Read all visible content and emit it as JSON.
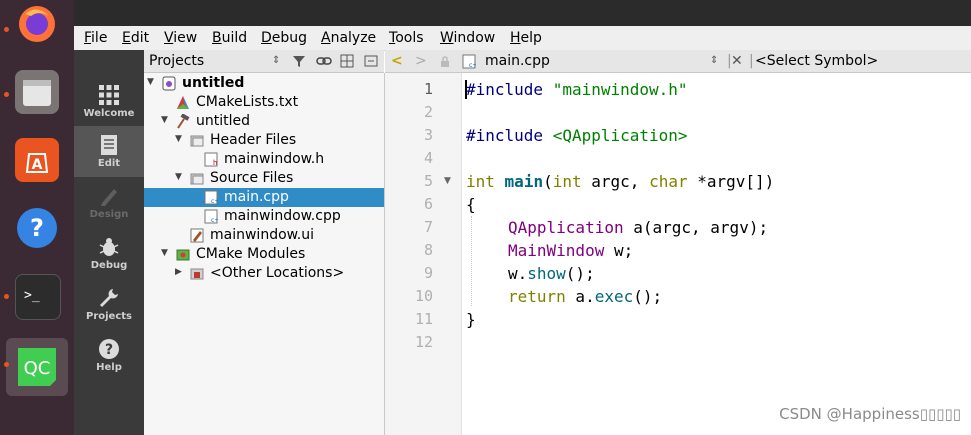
{
  "menubar": {
    "items": [
      "File",
      "Edit",
      "View",
      "Build",
      "Debug",
      "Analyze",
      "Tools",
      "Window",
      "Help"
    ]
  },
  "modes": [
    {
      "label": "Welcome",
      "icon": "welcome-grid-icon"
    },
    {
      "label": "Edit",
      "icon": "edit-document-icon"
    },
    {
      "label": "Design",
      "icon": "design-pen-icon"
    },
    {
      "label": "Debug",
      "icon": "debug-bug-icon"
    },
    {
      "label": "Projects",
      "icon": "projects-wrench-icon"
    },
    {
      "label": "Help",
      "icon": "help-question-icon"
    }
  ],
  "projects": {
    "title": "Projects",
    "tree": [
      {
        "label": "untitled",
        "bold": true
      },
      {
        "label": "CMakeLists.txt"
      },
      {
        "label": "untitled"
      },
      {
        "label": "Header Files"
      },
      {
        "label": "mainwindow.h"
      },
      {
        "label": "Source Files"
      },
      {
        "label": "main.cpp",
        "selected": true
      },
      {
        "label": "mainwindow.cpp"
      },
      {
        "label": "mainwindow.ui"
      },
      {
        "label": "CMake Modules"
      },
      {
        "label": "<Other Locations>"
      }
    ]
  },
  "editor": {
    "file_name": "main.cpp",
    "symbol_selector": "<Select Symbol>",
    "line_numbers": [
      "1",
      "2",
      "3",
      "4",
      "5",
      "6",
      "7",
      "8",
      "9",
      "10",
      "11",
      "12"
    ],
    "code": {
      "l1_directive": "#include",
      "l1_string": "\"mainwindow.h\"",
      "l3_directive": "#include",
      "l3_string": "<QApplication>",
      "l5_int": "int",
      "l5_main": "main",
      "l5_paren": "(",
      "l5_int2": "int",
      "l5_argc": " argc, ",
      "l5_char": "char",
      "l5_argv": " *argv[])",
      "l6": "{",
      "l7_type": "QApplication",
      "l7_rest": " a(argc, argv);",
      "l8_type": "MainWindow",
      "l8_rest": " w;",
      "l9_obj": "w.",
      "l9_call": "show",
      "l9_rest": "();",
      "l10_return": "return",
      "l10_obj": " a.",
      "l10_call": "exec",
      "l10_rest": "();",
      "l11": "}"
    }
  },
  "watermark": "CSDN @Happiness▯▯▯▯▯",
  "colors": {
    "dock": "#3b2a33",
    "selection": "#308cc6",
    "keyword": "#808000",
    "preprocessor": "#000080",
    "string": "#008000",
    "type": "#800080"
  }
}
